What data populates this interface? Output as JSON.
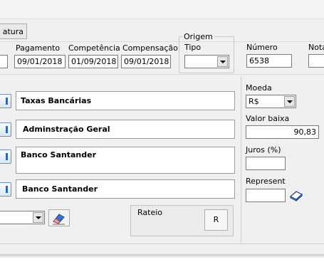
{
  "tabs": {
    "fatura_label": "atura"
  },
  "dates": {
    "pagamento_label": "Pagamento",
    "pagamento_value": "09/01/2018",
    "competencia_label": "Competência",
    "competencia_value": "01/09/2018",
    "compensacao_label": "Compensação",
    "compensacao_value": "09/01/2018"
  },
  "origem": {
    "group_label": "Origem",
    "tipo_label": "Tipo",
    "tipo_value": ""
  },
  "numero": {
    "label": "Número",
    "value": "6538"
  },
  "nota": {
    "label": "Nota"
  },
  "accounts": {
    "field1": "Taxas Bancárias",
    "field2": "Adminstração Geral",
    "field3": "Banco Santander",
    "field4": "Banco Santander"
  },
  "bottom": {
    "dropdown_value": ""
  },
  "rateio": {
    "label": "Rateio",
    "button_label": "R"
  },
  "right_panel": {
    "moeda_label": "Moeda",
    "moeda_value": "R$",
    "valor_baixa_label": "Valor baixa",
    "valor_baixa_value": "90,83",
    "juros_label": "Juros (%)",
    "juros_value": "",
    "represent_label": "Represent",
    "represent_value": ""
  }
}
